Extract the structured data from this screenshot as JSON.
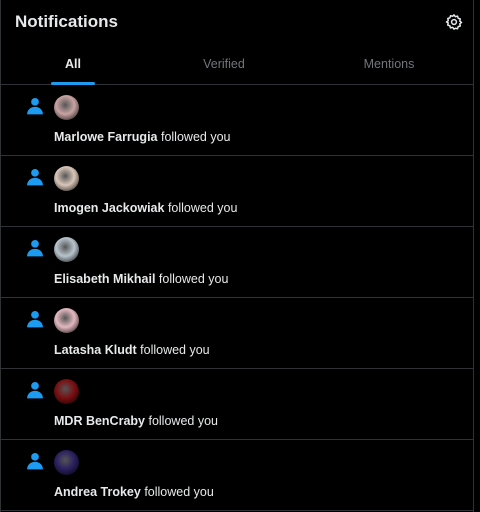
{
  "header": {
    "title": "Notifications"
  },
  "tabs": [
    {
      "label": "All",
      "active": true
    },
    {
      "label": "Verified",
      "active": false
    },
    {
      "label": "Mentions",
      "active": false
    }
  ],
  "notifications": [
    {
      "name": "Marlowe Farrugia",
      "action": "followed you",
      "avatar_color": "#c9a3a3"
    },
    {
      "name": "Imogen Jackowiak",
      "action": "followed you",
      "avatar_color": "#d8c6b8"
    },
    {
      "name": "Elisabeth Mikhail",
      "action": "followed you",
      "avatar_color": "#b8c4cc"
    },
    {
      "name": "Latasha Kludt",
      "action": "followed you",
      "avatar_color": "#e3b8c0"
    },
    {
      "name": "MDR BenCraby",
      "action": "followed you",
      "avatar_color": "#7a0f12"
    },
    {
      "name": "Andrea Trokey",
      "action": "followed you",
      "avatar_color": "#2a2060"
    }
  ],
  "colors": {
    "accent": "#1d9bf0",
    "muted": "#71767b",
    "border": "#2f3336"
  },
  "icons": {
    "settings": "gear-icon",
    "follow": "person-icon"
  }
}
